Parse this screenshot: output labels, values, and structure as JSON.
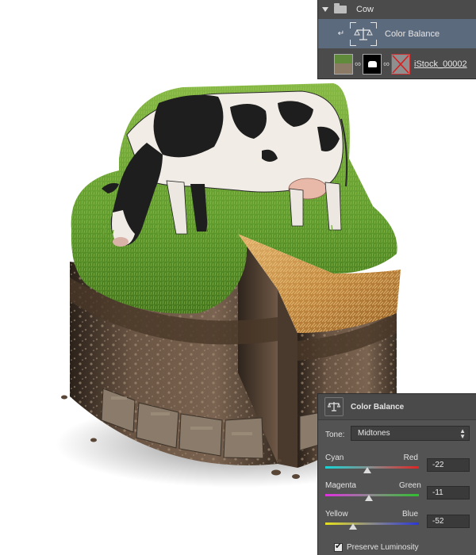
{
  "layers_panel": {
    "group_name": "Cow",
    "adjustment_layer_name": "Color Balance",
    "image_layer_name": "iStock_00002"
  },
  "properties_panel": {
    "title": "Color Balance",
    "tone_label": "Tone:",
    "tone_value": "Midtones",
    "sliders": [
      {
        "left": "Cyan",
        "right": "Red",
        "value": "-22",
        "fraction": 0.445
      },
      {
        "left": "Magenta",
        "right": "Green",
        "value": "-11",
        "fraction": 0.47
      },
      {
        "left": "Yellow",
        "right": "Blue",
        "value": "-52",
        "fraction": 0.3
      }
    ],
    "preserve_luminosity_label": "Preserve Luminosity",
    "preserve_luminosity_checked": true
  },
  "colors": {
    "panel_bg": "#535353",
    "selected_layer_bg": "#5c6a7e",
    "grass": "#5f9a2e",
    "wheat": "#c7924b",
    "soil": "#5b4636"
  },
  "icons": [
    "disclosure-triangle-icon",
    "folder-icon",
    "clip-arrow-icon",
    "scale-balance-icon",
    "chain-link-icon",
    "dropdown-arrows-icon",
    "checkmark-icon"
  ]
}
